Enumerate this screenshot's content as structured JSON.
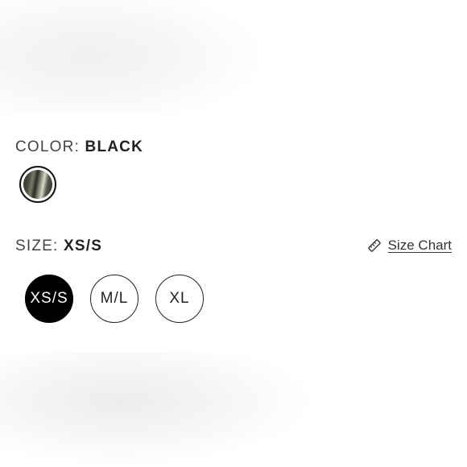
{
  "color_option": {
    "label": "COLOR:",
    "value": "BLACK",
    "swatches": [
      {
        "name": "Black",
        "selected": true
      }
    ]
  },
  "size_option": {
    "label": "SIZE:",
    "value": "XS/S",
    "sizes": [
      {
        "label": "XS/S",
        "selected": true
      },
      {
        "label": "M/L",
        "selected": false
      },
      {
        "label": "XL",
        "selected": false
      }
    ]
  },
  "size_chart": {
    "label": "Size Chart",
    "icon": "ruler-icon"
  },
  "colors": {
    "selected_bg": "#000000",
    "text": "#222222"
  }
}
